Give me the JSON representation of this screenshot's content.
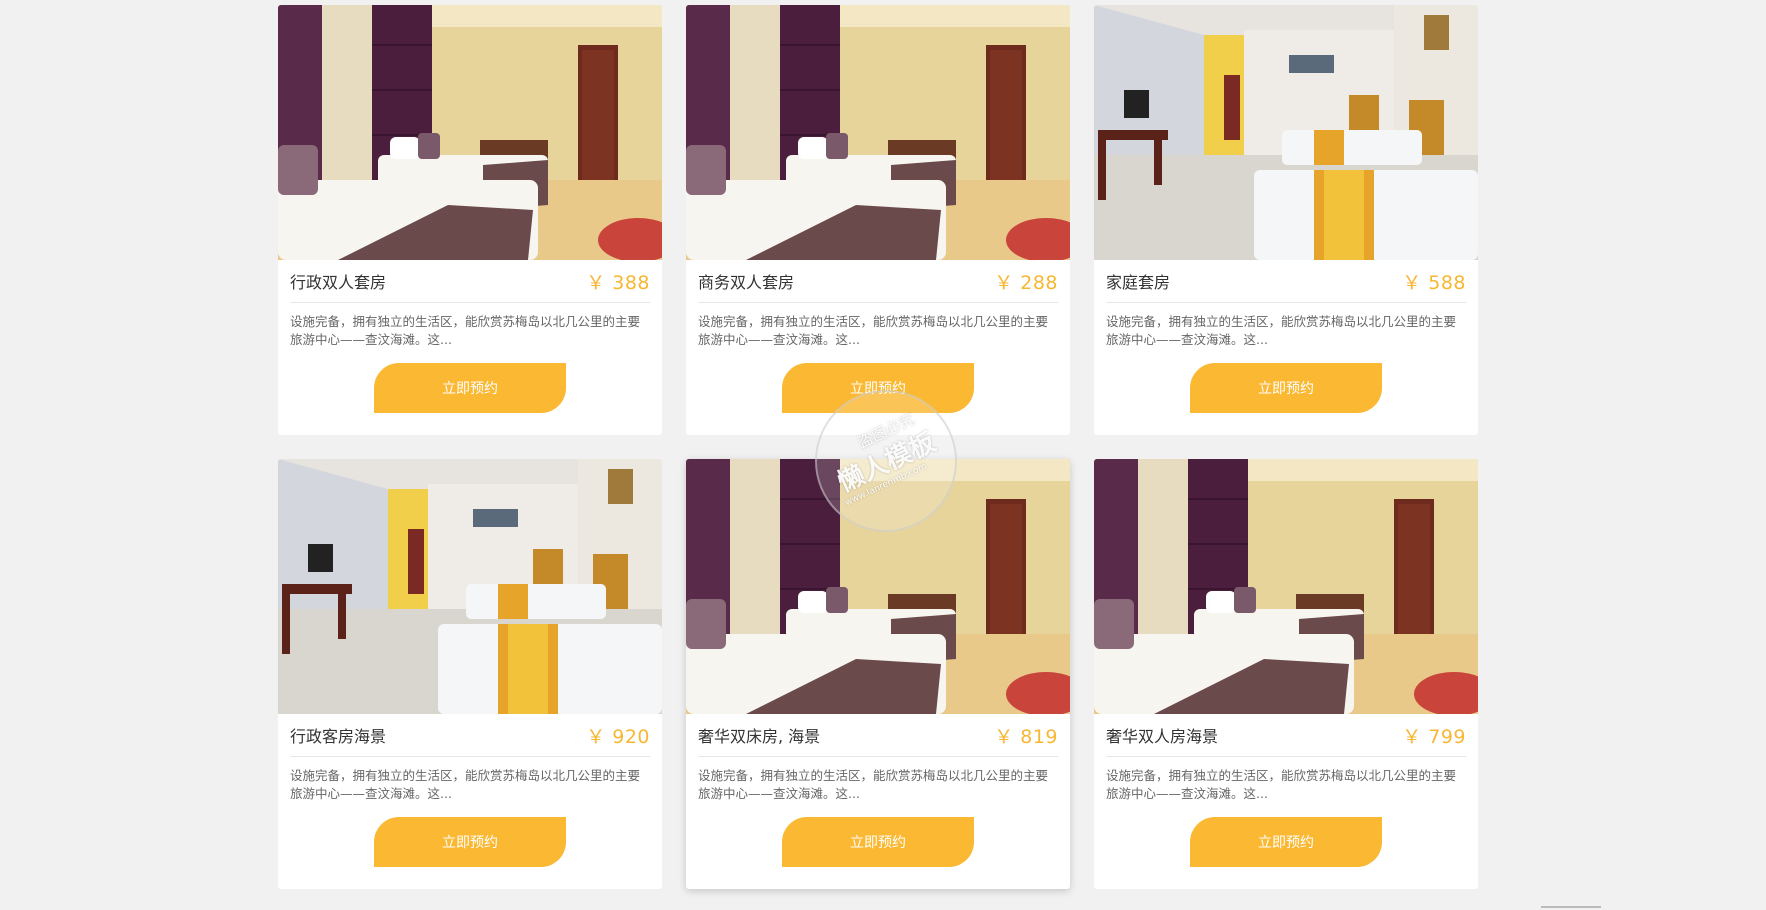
{
  "rooms": [
    {
      "name": "行政双人套房",
      "price": "￥ 388",
      "desc": "设施完备，拥有独立的生活区，能欣赏苏梅岛以北几公里的主要旅游中心——查汶海滩。这...",
      "button": "立即预约",
      "scene": "purple"
    },
    {
      "name": "商务双人套房",
      "price": "￥ 288",
      "desc": "设施完备，拥有独立的生活区，能欣赏苏梅岛以北几公里的主要旅游中心——查汶海滩。这...",
      "button": "立即预约",
      "scene": "purple"
    },
    {
      "name": "家庭套房",
      "price": "￥ 588",
      "desc": "设施完备，拥有独立的生活区，能欣赏苏梅岛以北几公里的主要旅游中心——查汶海滩。这...",
      "button": "立即预约",
      "scene": "twin"
    },
    {
      "name": "行政客房海景",
      "price": "￥ 920",
      "desc": "设施完备，拥有独立的生活区，能欣赏苏梅岛以北几公里的主要旅游中心——查汶海滩。这...",
      "button": "立即预约",
      "scene": "twin"
    },
    {
      "name": "奢华双床房, 海景",
      "price": "￥ 819",
      "desc": "设施完备，拥有独立的生活区，能欣赏苏梅岛以北几公里的主要旅游中心——查汶海滩。这...",
      "button": "立即预约",
      "scene": "purple"
    },
    {
      "name": "奢华双人房海景",
      "price": "￥ 799",
      "desc": "设施完备，拥有独立的生活区，能欣赏苏梅岛以北几公里的主要旅游中心——查汶海滩。这...",
      "button": "立即预约",
      "scene": "purple"
    }
  ],
  "watermark": {
    "line1": "盗图必究",
    "line2": "懒人模板",
    "line3": "www.lanrenmb.com"
  },
  "colors": {
    "accent": "#fbb833",
    "price": "#f7b733",
    "background": "#f1f1f1"
  }
}
